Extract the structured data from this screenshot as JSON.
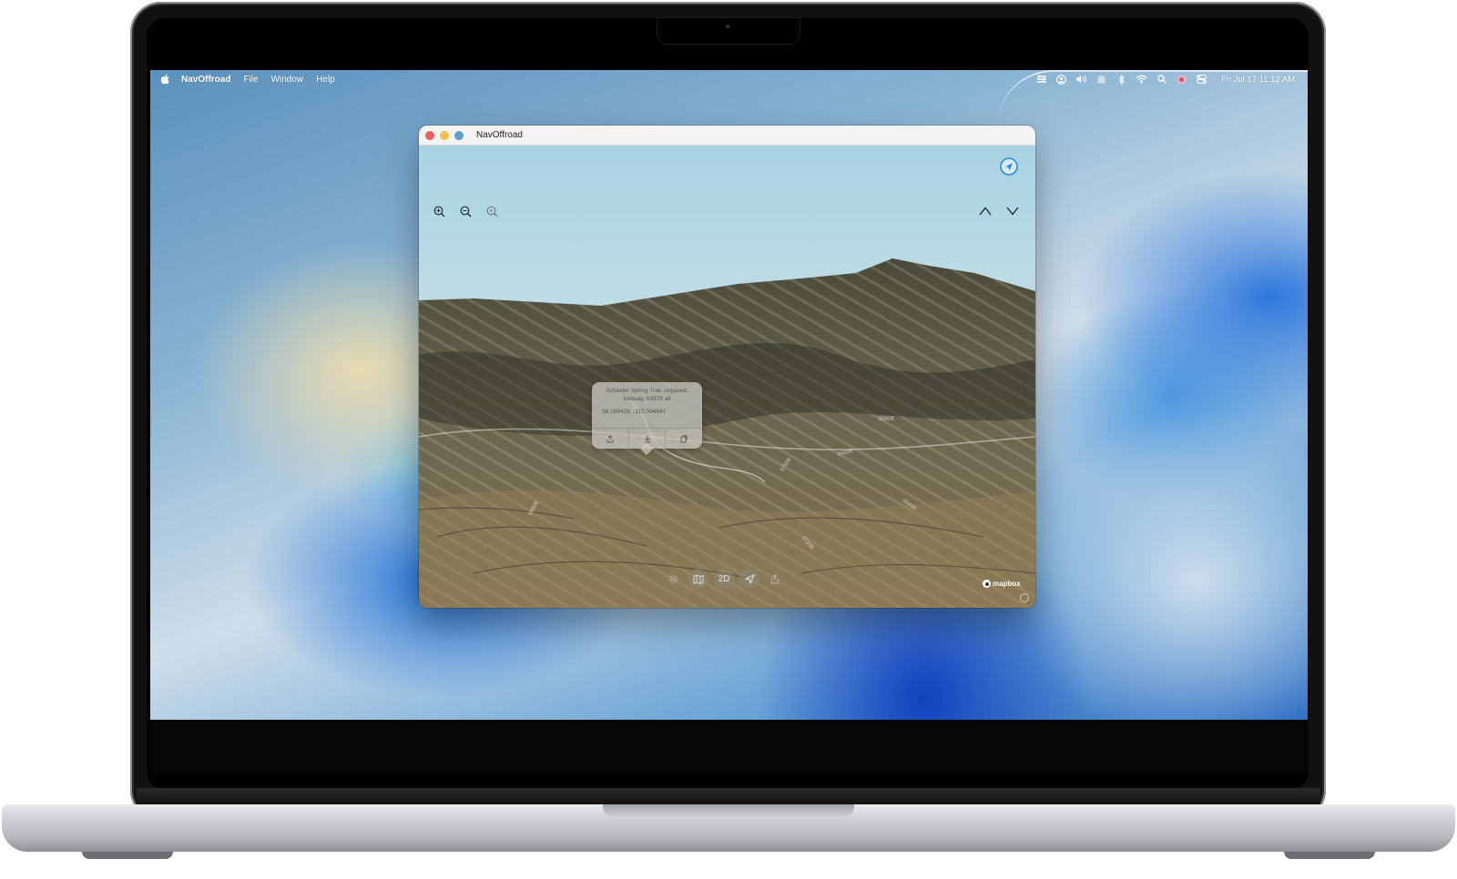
{
  "menu_bar": {
    "app_name": "NavOffroad",
    "menus": [
      "File",
      "Window",
      "Help"
    ],
    "clock": "Fri Jul 17  11:12 AM",
    "status_icons": [
      "options-icon",
      "user-icon",
      "volume-icon",
      "ghost-icon",
      "bluetooth-icon",
      "wifi-icon",
      "search-icon",
      "siri-icon",
      "control-center-icon"
    ]
  },
  "window": {
    "title": "NavOffroad"
  },
  "map": {
    "zoom_icons": [
      "zoom-in-icon",
      "zoom-out-icon",
      "zoom-reset-icon"
    ],
    "pitch_icons": [
      "pitch-up-icon",
      "pitch-down-icon"
    ],
    "popup": {
      "title": "Schaefer Spring Trail, unpaved, footway, 6387ft alt",
      "coords": "38.169428, -115.594641",
      "actions": [
        "share-icon",
        "download-icon",
        "copy-icon"
      ]
    },
    "toolbar": {
      "settings_icon": "gear-icon",
      "map_icon": "map-icon",
      "mode_label": "2D",
      "locate_icon": "location-arrow-icon",
      "share_icon": "share-icon"
    },
    "attribution": "mapbox",
    "contour_labels": [
      "6880ft",
      "6840ft",
      "6720ft",
      "6760ft",
      "6560ft",
      "6600ft"
    ]
  },
  "colors": {
    "accent": "#2a8ae0",
    "close": "#ed5f57",
    "minimize": "#f4bd4f",
    "zoom": "#5fa0c4"
  }
}
